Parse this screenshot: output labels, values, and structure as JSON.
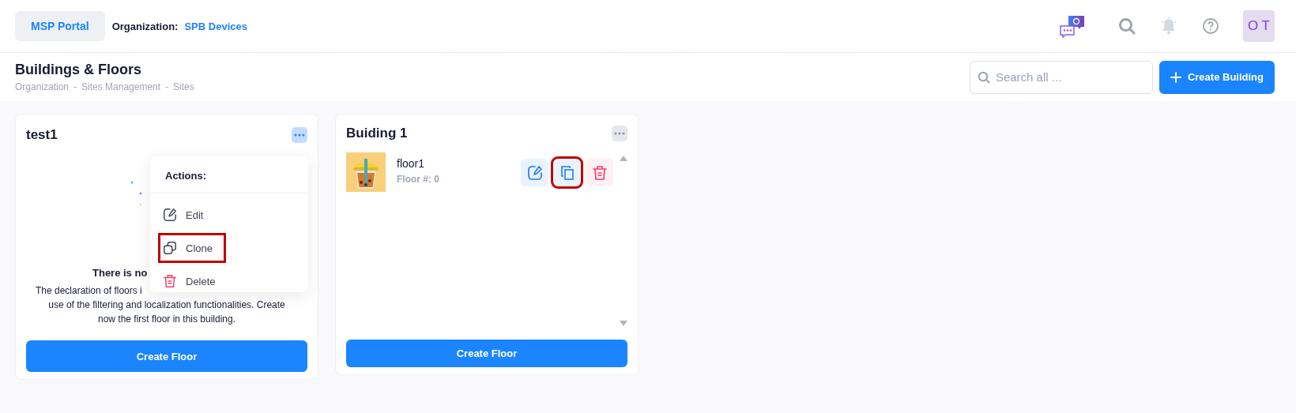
{
  "header": {
    "portal_button": "MSP Portal",
    "org_label": "Organization:",
    "org_name": "SPB Devices",
    "avatar": "O T"
  },
  "page": {
    "title": "Buildings & Floors",
    "breadcrumb": [
      "Organization",
      "Sites Management",
      "Sites"
    ],
    "breadcrumb_separator": "-",
    "search": {
      "placeholder": "Search all ..."
    },
    "create_button": "Create Building"
  },
  "buildings": [
    {
      "kind": "empty",
      "name": "test1",
      "menu_open": true,
      "empty_state": {
        "title": "There is no",
        "description_lines": [
          "The declaration of floors i",
          "use of the filtering and localization functionalities. Create",
          "now the first floor in this building."
        ]
      },
      "actions_menu": {
        "title": "Actions:",
        "items": [
          {
            "kind": "edit",
            "label": "Edit",
            "highlighted": false
          },
          {
            "kind": "clone",
            "label": "Clone",
            "highlighted": true
          },
          {
            "kind": "delete",
            "label": "Delete",
            "highlighted": false
          }
        ]
      },
      "create_button": "Create Floor"
    },
    {
      "kind": "list",
      "name": "Buiding 1",
      "menu_open": false,
      "floors": [
        {
          "name": "floor1",
          "number": "Floor #: 0",
          "actions": [
            {
              "kind": "edit",
              "highlighted": false
            },
            {
              "kind": "clone",
              "highlighted": true
            },
            {
              "kind": "delete",
              "highlighted": false
            }
          ]
        }
      ],
      "create_button": "Create Floor"
    }
  ]
}
